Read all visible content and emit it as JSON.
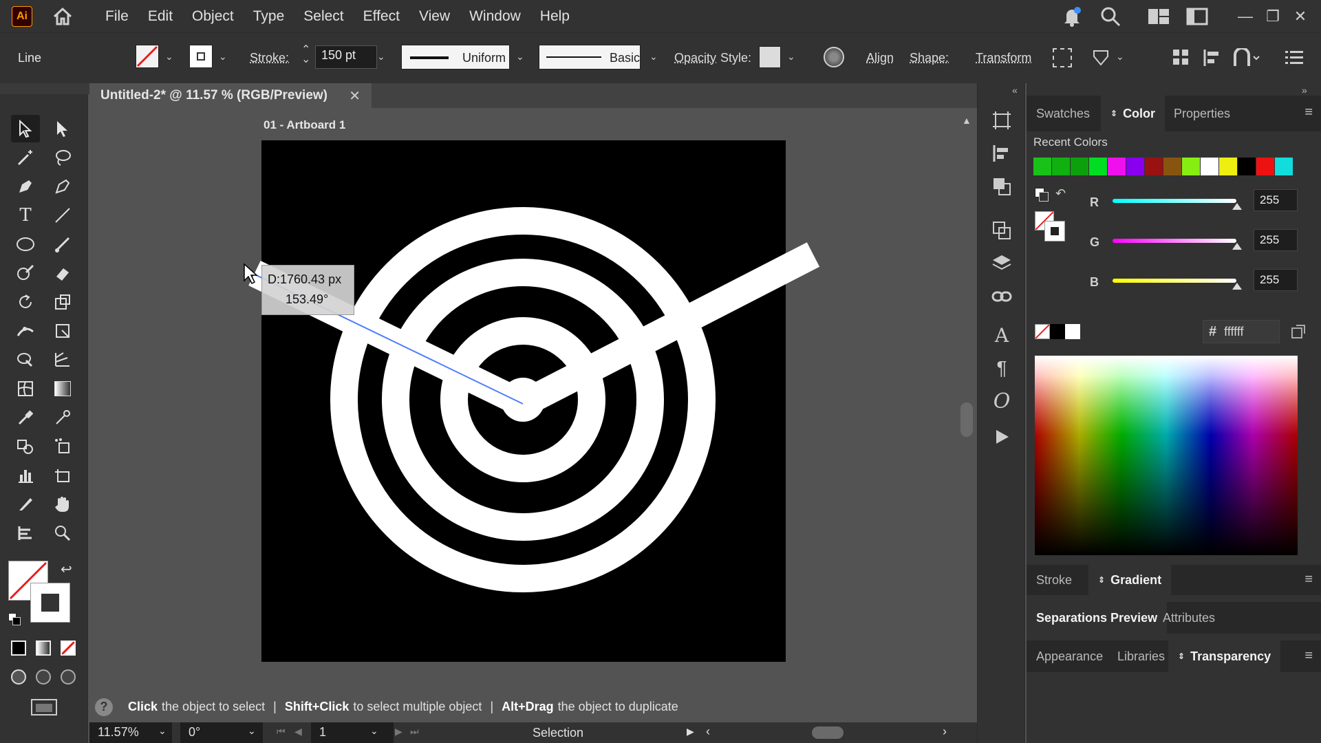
{
  "app": {
    "logo_text": "Ai"
  },
  "menu": [
    "File",
    "Edit",
    "Object",
    "Type",
    "Select",
    "Effect",
    "View",
    "Window",
    "Help"
  ],
  "control": {
    "tool_name": "Line",
    "stroke_label": "Stroke:",
    "stroke_value": "150 pt",
    "profile_label": "Uniform",
    "brush_label": "Basic",
    "opacity_label": "Opacity",
    "style_label": "Style:",
    "align_label": "Align",
    "shape_label": "Shape:",
    "transform_label": "Transform"
  },
  "document": {
    "tab_title": "Untitled-2* @ 11.57 % (RGB/Preview)",
    "close_glyph": "✕",
    "artboard_label": "01 - Artboard 1"
  },
  "tooltip": {
    "distance": "D:1760.43 px",
    "angle": "153.49°"
  },
  "status": {
    "hint1_bold": "Click",
    "hint1": "the object to select",
    "hint2_bold": "Shift+Click",
    "hint2": "to select multiple object",
    "hint3_bold": "Alt+Drag",
    "hint3": "the object to duplicate",
    "separator": "|"
  },
  "bottom": {
    "zoom": "11.57%",
    "rotation": "0°",
    "artboard_num": "1",
    "mode": "Selection"
  },
  "panels": {
    "top_tabs": [
      "Swatches",
      "Color",
      "Properties"
    ],
    "recent_colors_label": "Recent Colors",
    "recent_colors": [
      "#19c219",
      "#11b011",
      "#0da00d",
      "#00dd22",
      "#ee11ee",
      "#8800ee",
      "#991111",
      "#885511",
      "#88ee11",
      "#ffffff",
      "#eeee11",
      "#000000",
      "#ee1111",
      "#11dddd"
    ],
    "r_label": "R",
    "r_value": "255",
    "g_label": "G",
    "g_value": "255",
    "b_label": "B",
    "b_value": "255",
    "hex_symbol": "#",
    "hex_value": "ffffff",
    "stroke_tabs": [
      "Stroke",
      "Gradient"
    ],
    "sep_tabs": [
      "Separations Preview",
      "Attributes"
    ],
    "app_tabs": [
      "Appearance",
      "Libraries",
      "Transparency"
    ]
  }
}
